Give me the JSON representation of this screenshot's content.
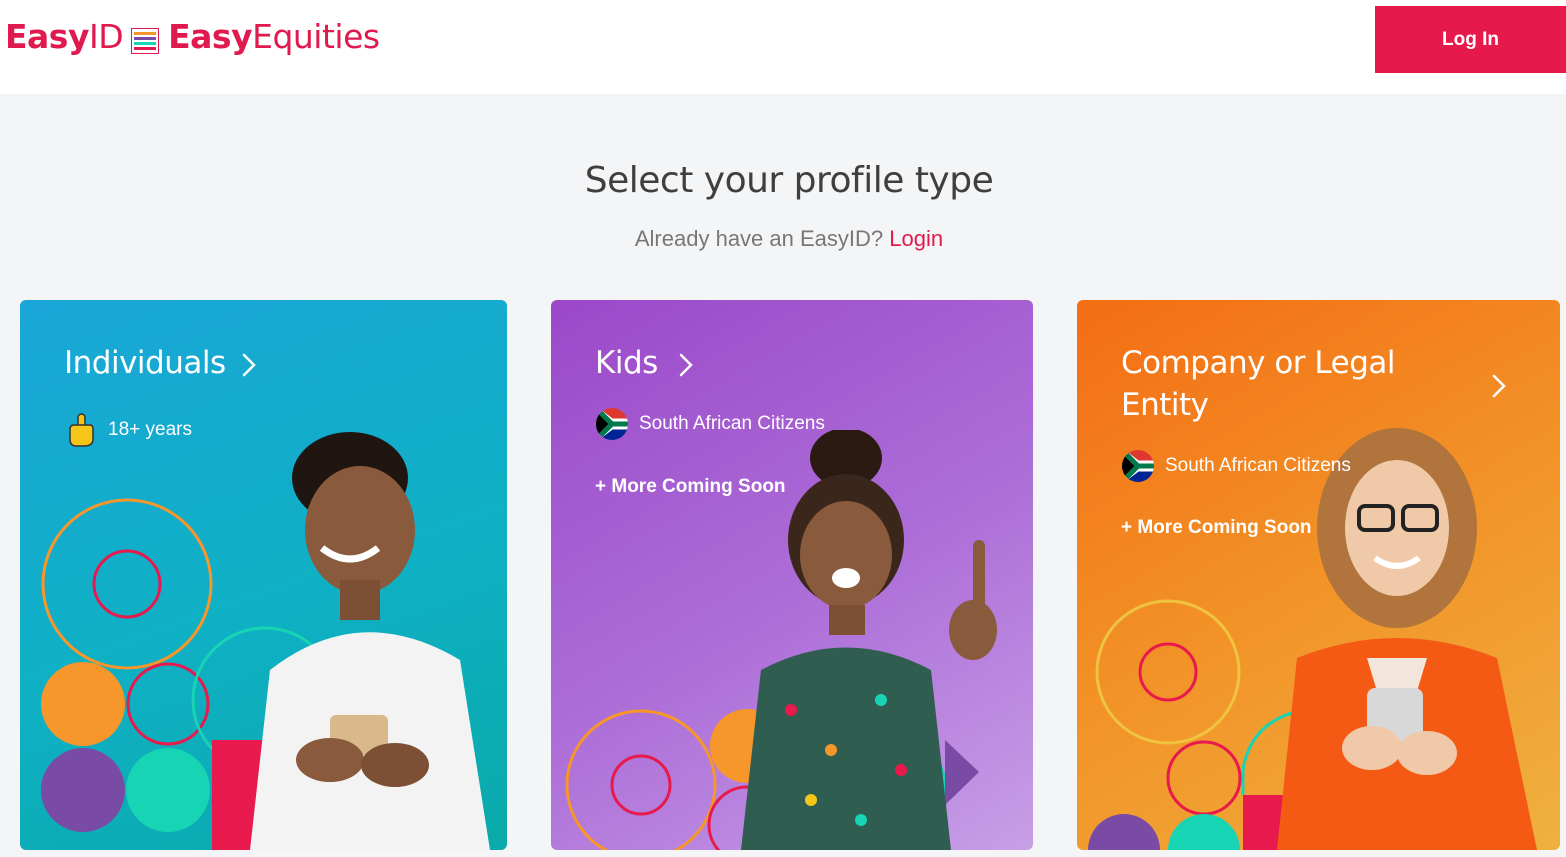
{
  "header": {
    "logo_easy": "Easy",
    "logo_id": "ID",
    "logo_brand_easy": "Easy",
    "logo_brand_equities": "Equities",
    "login_label": "Log In"
  },
  "main": {
    "title": "Select your profile type",
    "subtitle_prefix": "Already have an EasyID?",
    "subtitle_link": "Login"
  },
  "cards": [
    {
      "title": "Individuals",
      "meta": "18+ years",
      "meta_icon": "pointing-hand-icon"
    },
    {
      "title": "Kids",
      "meta": "South African Citizens",
      "meta_icon": "south-africa-flag-icon",
      "more": "+ More Coming Soon"
    },
    {
      "title_line1": "Company or Legal",
      "title_line2": "Entity",
      "meta": "South African Citizens",
      "meta_icon": "south-africa-flag-icon",
      "more": "+ More Coming Soon"
    }
  ],
  "colors": {
    "brand": "#e01a4f",
    "button": "#e6194b",
    "individuals": "#15a9cf",
    "kids": "#a55ad0",
    "company": "#f3801e",
    "deco_orange": "#f7962a",
    "deco_purple": "#7a4ba4",
    "deco_teal": "#16d4b4",
    "deco_red": "#e8194c"
  }
}
